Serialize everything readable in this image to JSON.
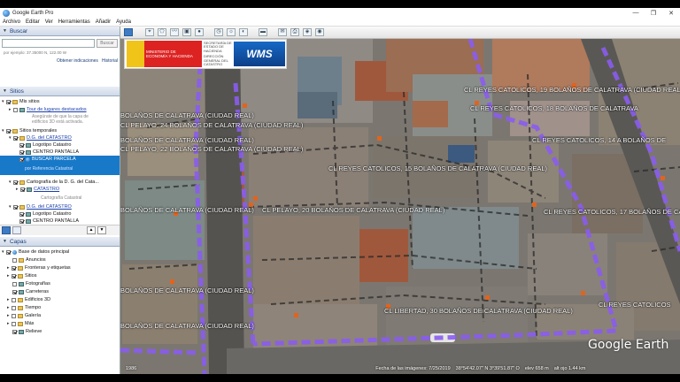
{
  "window": {
    "title": "Google Earth Pro",
    "minimize": "—",
    "maximize": "❐",
    "close": "✕"
  },
  "menu": [
    "Archivo",
    "Editar",
    "Ver",
    "Herramientas",
    "Añadir",
    "Ayuda"
  ],
  "search": {
    "header": "Buscar",
    "button": "Buscar",
    "hint": "por ejemplo: 37.35000 N, 122.00 W",
    "links": [
      "Obtener indicaciones",
      "Historial"
    ]
  },
  "places": {
    "header": "Sitios",
    "items": [
      {
        "label": "Mis sitios",
        "style": "plain"
      },
      {
        "label": "Tour de lugares destacados",
        "style": "link"
      },
      {
        "label": "Asegúrate de que la capa de",
        "style": "sub"
      },
      {
        "label": "edificios 3D está activada.",
        "style": "sub"
      },
      {
        "label": "Sitios temporales",
        "style": "plain"
      },
      {
        "label": "D.G. del CATASTRO",
        "style": "link"
      },
      {
        "label": "Logotipo Catastro",
        "style": "plain"
      },
      {
        "label": "CENTRO PANTALLA",
        "style": "plain"
      },
      {
        "label": "BUSCAR PARCELA",
        "style": "selected"
      },
      {
        "label": "por Referencia Catastral",
        "style": "sub-sel"
      },
      {
        "label": "Cartografía de la D. G. del Cata...",
        "style": "plain"
      },
      {
        "label": "CATASTRO",
        "style": "link"
      },
      {
        "label": "Cartografía Catastral",
        "style": "sub"
      },
      {
        "label": "D.G. del CATASTRO",
        "style": "link"
      },
      {
        "label": "Logotipo Catastro",
        "style": "plain"
      },
      {
        "label": "CENTRO PANTALLA",
        "style": "plain"
      }
    ],
    "nav_up": "▲",
    "nav_down": "▼"
  },
  "layers": {
    "header": "Capas",
    "items": [
      "Base de datos principal",
      "Anuncios",
      "Fronteras y etiquetas",
      "Sitios",
      "Fotografías",
      "Carreteras",
      "Edificios 3D",
      "Tiempo",
      "Galería",
      "Más",
      "Relieve"
    ]
  },
  "toolbar": {
    "icons": [
      "sidebar-icon",
      "placemark-icon",
      "polygon-icon",
      "path-icon",
      "overlay-icon",
      "tour-icon",
      "history-icon",
      "sun-icon",
      "planets-icon",
      "ruler-icon",
      "email-icon",
      "print-icon",
      "maps-icon",
      "kml-icon"
    ]
  },
  "banner": {
    "ministry": "MINISTERIO DE ECONOMÍA Y HACIENDA",
    "secretary": "SECRETARÍA DE ESTADO DE HACIENDA",
    "directorate": "DIRECCIÓN GENERAL DEL CATASTRO",
    "wms": "WMS"
  },
  "map_labels": [
    "CL REYES CATOLICOS, 19 BOLAÑOS DE CALATRAVA (CIUDAD REAL)",
    "CL REYES CATOLICOS, 18 BOLAÑOS DE CALATRAVA",
    "BOLAÑOS DE CALATRAVA (CIUDAD REAL)",
    "CL PELAYO, 24 BOLAÑOS DE CALATRAVA (CIUDAD REAL)",
    "BOLAÑOS DE CALATRAVA (CIUDAD REAL)",
    "CL REYES CATOLICOS, 14 A BOLAÑOS DE",
    "CL PELAYO, 22 BOLAÑOS DE CALATRAVA (CIUDAD REAL)",
    "CL REYES CATOLICOS, 15 BOLAÑOS DE CALATRAVA (CIUDAD REAL)",
    "BOLAÑOS DE CALATRAVA (CIUDAD REAL)",
    "CL PELAYO, 20 BOLAÑOS DE CALATRAVA (CIUDAD REAL)",
    "CL REYES CATOLICOS, 17 BOLAÑOS DE CAL",
    "BOLAÑOS DE CALATRAVA (CIUDAD REAL)",
    "CL REYES CATOLICOS",
    "BOLAÑOS DE CALATRAVA (CIUDAD REAL)",
    "CL LIBERTAD, 30 BOLAÑOS DE CALATRAVA (CIUDAD REAL)"
  ],
  "brand": "Google Earth",
  "status": {
    "year": "1986",
    "imagery_date": "Fecha de las imágenes: 7/25/2019",
    "coords": "38°54'42.07\" N  3°39'51.87\" O",
    "elevation": "elev 658 m",
    "altitude": "alt ojo 1.44 km"
  },
  "colors": {
    "boundary": "#8a5cf0",
    "accent": "#1979c9"
  }
}
